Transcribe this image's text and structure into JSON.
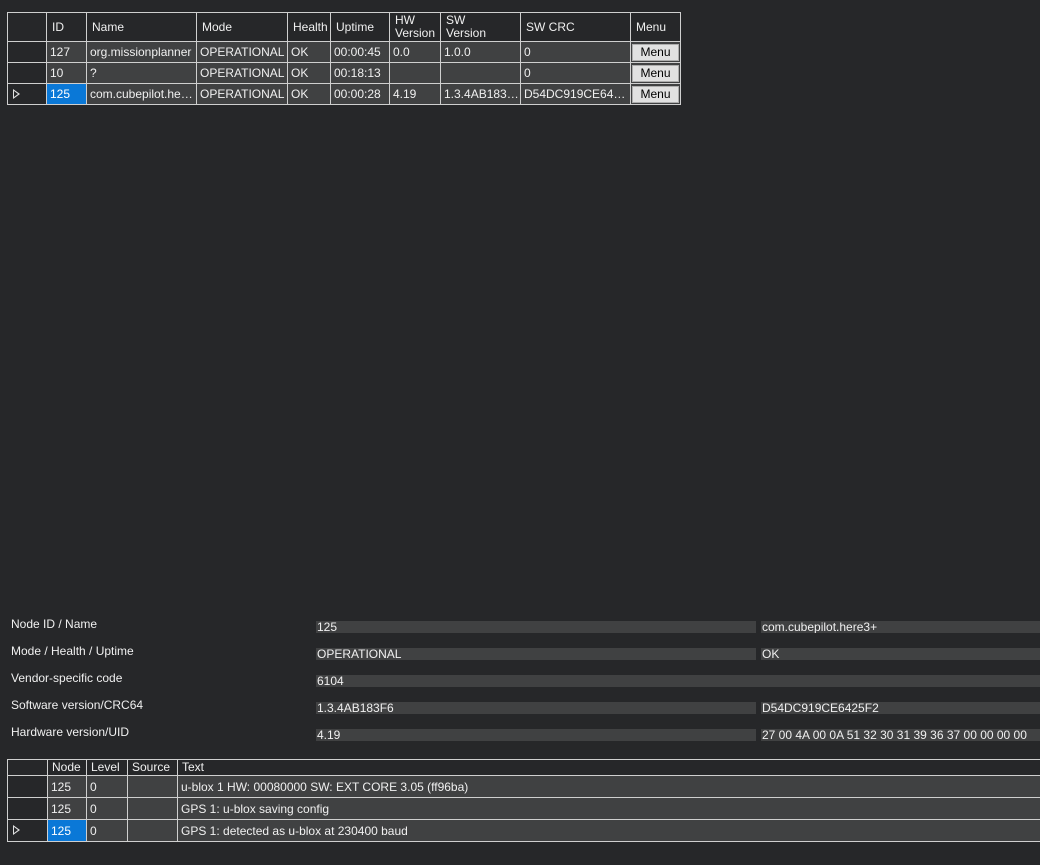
{
  "nodes_table": {
    "headers": {
      "id": "ID",
      "name": "Name",
      "mode": "Mode",
      "health": "Health",
      "uptime": "Uptime",
      "hw_line1": "HW",
      "hw_line2": "Version",
      "sw_line1": "SW",
      "sw_line2": "Version",
      "sw_crc": "SW CRC",
      "menu": "Menu"
    },
    "rows": [
      {
        "id": "127",
        "name": "org.missionplanner",
        "mode": "OPERATIONAL",
        "health": "OK",
        "uptime": "00:00:45",
        "hw_version": "0.0",
        "sw_version": "1.0.0",
        "sw_crc": "0",
        "menu_label": "Menu"
      },
      {
        "id": "10",
        "name": "?",
        "mode": "OPERATIONAL",
        "health": "OK",
        "uptime": "00:18:13",
        "hw_version": "",
        "sw_version": "",
        "sw_crc": "0",
        "menu_label": "Menu"
      },
      {
        "id": "125",
        "name": "com.cubepilot.here3+",
        "mode": "OPERATIONAL",
        "health": "OK",
        "uptime": "00:00:28",
        "hw_version": "4.19",
        "sw_version": "1.3.4AB183F6",
        "sw_crc": "D54DC919CE6425...",
        "menu_label": "Menu"
      }
    ]
  },
  "node_info": {
    "node_id_name": {
      "label": "Node ID / Name",
      "value1": "125",
      "value2": "com.cubepilot.here3+"
    },
    "mode_health_uptime": {
      "label": "Mode / Health / Uptime",
      "value1": "OPERATIONAL",
      "value2": "OK"
    },
    "vendor_code": {
      "label": "Vendor-specific code",
      "value1": "6104"
    },
    "software_version": {
      "label": "Software version/CRC64",
      "value1": "1.3.4AB183F6",
      "value2": "D54DC919CE6425F2"
    },
    "hardware_version": {
      "label": "Hardware version/UID",
      "value1": "4.19",
      "value2": "27 00 4A 00 0A 51 32 30 31 39 36 37 00 00 00 00"
    }
  },
  "log_table": {
    "headers": {
      "node": "Node",
      "level": "Level",
      "source": "Source",
      "text": "Text"
    },
    "rows": [
      {
        "node": "125",
        "level": "0",
        "source": "",
        "text": "u-blox 1 HW: 00080000 SW: EXT CORE 3.05 (ff96ba)"
      },
      {
        "node": "125",
        "level": "0",
        "source": "",
        "text": "GPS 1: u-blox saving config"
      },
      {
        "node": "125",
        "level": "0",
        "source": "",
        "text": "GPS 1: detected as u-blox at 230400 baud"
      }
    ]
  },
  "colors": {
    "background": "#262729",
    "cell": "#404142",
    "selection": "#0a78d7",
    "grid_line": "#cfcfcf"
  },
  "icons": {
    "current_row": "row-pointer-icon"
  }
}
